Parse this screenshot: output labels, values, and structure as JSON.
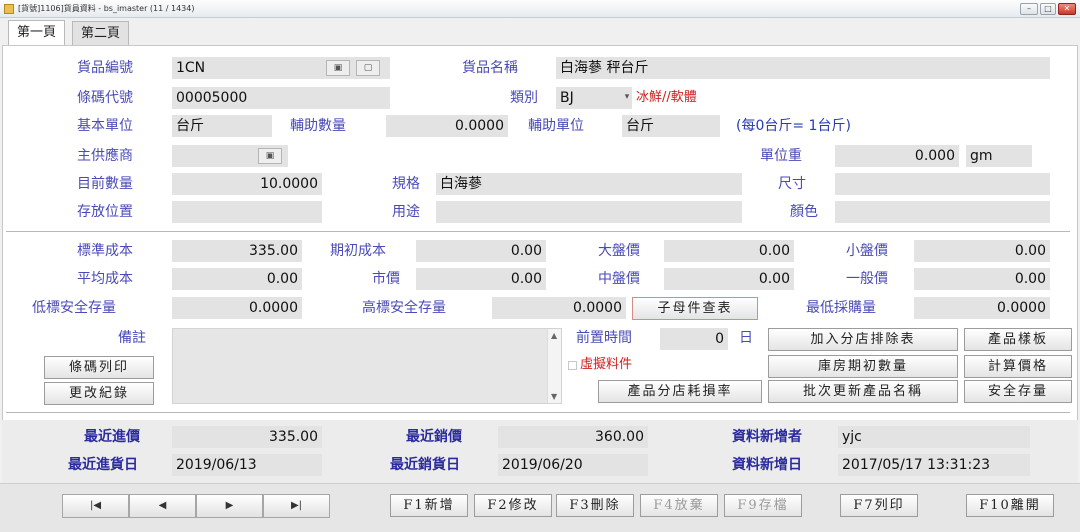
{
  "window": {
    "title": "[貨號]1106]貨員資料 - bs_imaster    (11 / 1434)"
  },
  "tabs": [
    {
      "label": "第一頁"
    },
    {
      "label": "第二頁"
    }
  ],
  "product": {
    "code_label": "貨品編號",
    "code": "1CN",
    "name_label": "貨品名稱",
    "name": "白海蔘 秤台斤",
    "barcode_label": "條碼代號",
    "barcode": "00005000",
    "category_label": "類別",
    "category": "BJ",
    "category_desc": "冰鮮//軟體",
    "base_unit_label": "基本單位",
    "base_unit": "台斤",
    "aux_qty_label": "輔助數量",
    "aux_qty": "0.0000",
    "aux_unit_label": "輔助單位",
    "aux_unit": "台斤",
    "unit_note": "(每0台斤= 1台斤)",
    "supplier_label": "主供應商",
    "supplier": "",
    "unit_weight_label": "單位重",
    "unit_weight": "0.000",
    "unit_weight_unit": "gm",
    "qty_label": "目前數量",
    "qty": "10.0000",
    "spec_label": "規格",
    "spec": "白海蔘",
    "size_label": "尺寸",
    "size": "",
    "location_label": "存放位置",
    "location": "",
    "usage_label": "用途",
    "usage": "",
    "color_label": "顏色",
    "color": ""
  },
  "cost": {
    "std_cost_label": "標準成本",
    "std_cost": "335.00",
    "init_cost_label": "期初成本",
    "init_cost": "0.00",
    "big_price_label": "大盤價",
    "big_price": "0.00",
    "small_price_label": "小盤價",
    "small_price": "0.00",
    "avg_cost_label": "平均成本",
    "avg_cost": "0.00",
    "market_price_label": "市價",
    "market_price": "0.00",
    "mid_price_label": "中盤價",
    "mid_price": "0.00",
    "general_price_label": "一般價",
    "general_price": "0.00",
    "low_stock_label": "低標安全存量",
    "low_stock": "0.0000",
    "high_stock_label": "高標安全存量",
    "high_stock": "0.0000",
    "bom_button": "子母件查表",
    "min_purchase_label": "最低採購量",
    "min_purchase": "0.0000"
  },
  "memo": {
    "label": "備註",
    "lead_time_label": "前置時間",
    "lead_time": "0",
    "lead_time_unit": "日",
    "virtual_label": "虛擬料件"
  },
  "buttons": {
    "barcode_print": "條碼列印",
    "change_log": "更改紀錄",
    "add_branch_exclude": "加入分店排除表",
    "product_template": "產品樣板",
    "warehouse_init_qty": "庫房期初數量",
    "calc_price": "計算價格",
    "branch_loss_rate": "產品分店耗損率",
    "batch_update_name": "批次更新產品名稱",
    "safety_stock": "安全存量"
  },
  "recent": {
    "last_in_price_label": "最近進價",
    "last_in_price": "335.00",
    "last_sale_price_label": "最近銷價",
    "last_sale_price": "360.00",
    "creator_label": "資料新增者",
    "creator": "yjc",
    "last_in_date_label": "最近進貨日",
    "last_in_date": "2019/06/13",
    "last_sale_date_label": "最近銷貨日",
    "last_sale_date": "2019/06/20",
    "created_date_label": "資料新增日",
    "created_date": "2017/05/17 13:31:23"
  },
  "toolbar": {
    "add": "F1新增",
    "edit": "F2修改",
    "delete": "F3刪除",
    "abandon": "F4放棄",
    "save": "F9存檔",
    "print": "F7列印",
    "exit": "F10離開"
  }
}
